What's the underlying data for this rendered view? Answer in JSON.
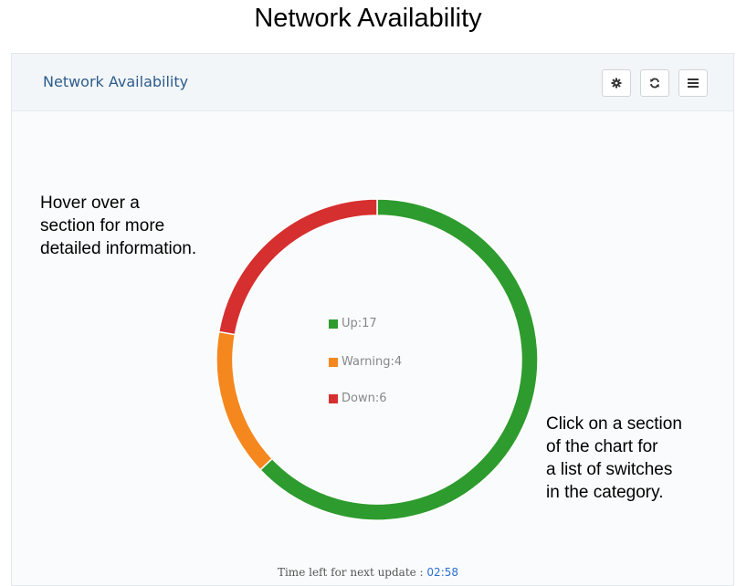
{
  "page": {
    "title": "Network Availability"
  },
  "panel": {
    "title": "Network Availability",
    "toolbar": {
      "settings_icon": "gear-icon",
      "refresh_icon": "refresh-icon",
      "menu_icon": "menu-icon"
    }
  },
  "chart_data": {
    "type": "pie",
    "variant": "donut",
    "categories": [
      "Up",
      "Warning",
      "Down"
    ],
    "values": [
      17,
      4,
      6
    ],
    "colors": [
      "#2e9b2e",
      "#f5871f",
      "#d62f2f"
    ],
    "labels": [
      "Up:17",
      "Warning:4",
      "Down:6"
    ]
  },
  "annotations": {
    "hover_line1": "Hover over a",
    "hover_line2": "section for more",
    "hover_line3": "detailed information.",
    "click_line1": "Click on a section",
    "click_line2": "of the chart for",
    "click_line3": "a list of switches",
    "click_line4": "in the category."
  },
  "footer": {
    "label": "Time left for next update : ",
    "timer": "02:58"
  }
}
